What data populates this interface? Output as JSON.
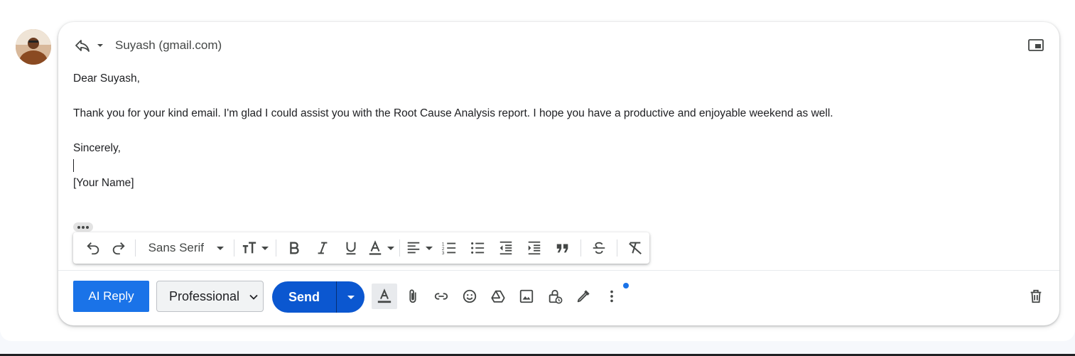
{
  "header": {
    "recipient": "Suyash (gmail.com)"
  },
  "message": {
    "lines": [
      "Dear Suyash,",
      "",
      "Thank you for your kind email. I'm glad I could assist you with the Root Cause Analysis report. I hope you have a productive and enjoyable weekend as well.",
      "",
      "Sincerely,",
      "",
      "[Your Name]"
    ]
  },
  "formatting": {
    "font": "Sans Serif"
  },
  "actions": {
    "ai_reply": "AI Reply",
    "tone_selected": "Professional",
    "send": "Send"
  },
  "colors": {
    "accent": "#1a73e8",
    "send": "#0b57d0"
  },
  "icons": [
    "reply-icon",
    "popout-icon",
    "undo-icon",
    "redo-icon",
    "text-size-icon",
    "bold-icon",
    "italic-icon",
    "underline-icon",
    "text-color-icon",
    "align-icon",
    "numbered-list-icon",
    "bulleted-list-icon",
    "indent-less-icon",
    "indent-more-icon",
    "quote-icon",
    "strikethrough-icon",
    "clear-formatting-icon",
    "formatting-options-icon",
    "attach-icon",
    "link-icon",
    "emoji-icon",
    "drive-icon",
    "photo-icon",
    "confidential-icon",
    "signature-icon",
    "more-options-icon",
    "trash-icon"
  ]
}
